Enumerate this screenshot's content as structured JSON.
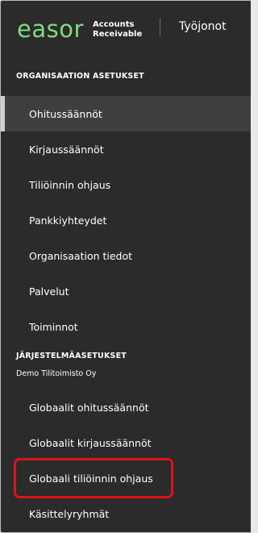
{
  "header": {
    "logo_text": "easor",
    "logo_sub_line1": "Accounts",
    "logo_sub_line2": "Receivable",
    "workqueues_label": "Työjonot"
  },
  "sections": {
    "org_title": "ORGANISAATION ASETUKSET",
    "org_items": [
      "Ohitussäännöt",
      "Kirjaussäännöt",
      "Tiliöinnin ohjaus",
      "Pankkiyhteydet",
      "Organisaation tiedot",
      "Palvelut",
      "Toiminnot"
    ],
    "sys_title": "JÄRJESTELMÄASETUKSET",
    "sys_subtitle": "Demo Tilitoimisto Oy",
    "sys_items": [
      "Globaalit ohitussäännöt",
      "Globaalit kirjaussäännöt",
      "Globaali tiliöinnin ohjaus",
      "Käsittelyryhmät"
    ]
  },
  "colors": {
    "panel_bg": "#2b2b2b",
    "logo_green": "#7fdc7f",
    "active_bg": "#3f3f3f",
    "highlight_red": "#e0101a"
  }
}
